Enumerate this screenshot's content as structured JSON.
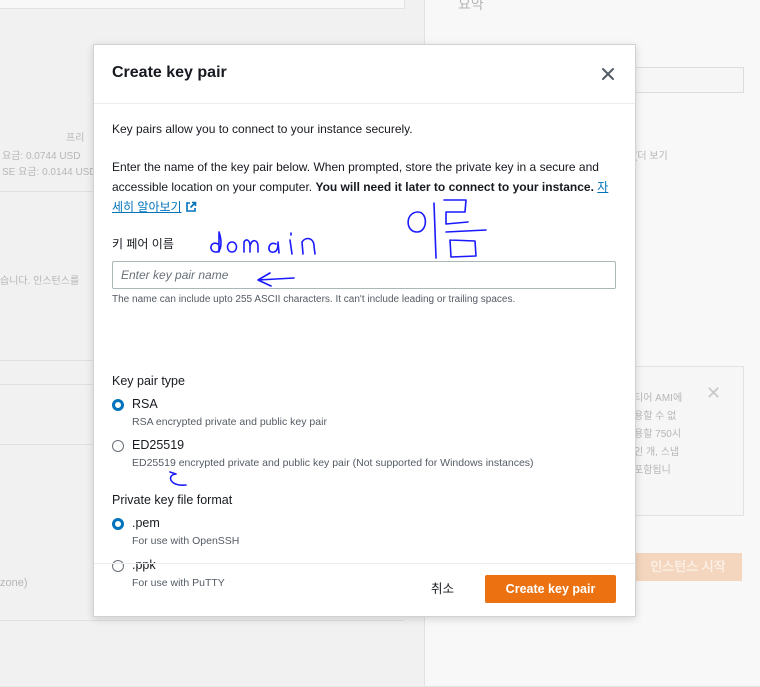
{
  "modal": {
    "title": "Create key pair",
    "intro": "Key pairs allow you to connect to your instance securely.",
    "description_plain": "Enter the name of the key pair below. When prompted, store the private key in a secure and accessible location on your computer.",
    "description_bold": "You will need it later to connect to your instance.",
    "learn_more_link": "자세히 알아보기",
    "name_field": {
      "label": "키 페어 이름",
      "placeholder": "Enter key pair name",
      "value": "",
      "hint": "The name can include upto 255 ASCII characters. It can't include leading or trailing spaces."
    },
    "key_pair_type": {
      "label": "Key pair type",
      "options": [
        {
          "title": "RSA",
          "description": "RSA encrypted private and public key pair",
          "selected": true
        },
        {
          "title": "ED25519",
          "description": "ED25519 encrypted private and public key pair (Not supported for Windows instances)",
          "selected": false
        }
      ]
    },
    "file_format": {
      "label": "Private key file format",
      "options": [
        {
          "title": ".pem",
          "description": "For use with OpenSSH",
          "selected": true
        },
        {
          "title": ".ppk",
          "description": "For use with PuTTY",
          "selected": false
        }
      ]
    },
    "cancel_label": "취소",
    "create_label": "Create key pair"
  },
  "background": {
    "texts": [
      "프리",
      "요금: 0.0744 USD",
      "SE 요금: 0.0144 USD",
      "습니다. 인스턴스를",
      "(더 보기",
      "티어 AMI에",
      "용할 수 없",
      "용할 750시",
      "인 개, 스냅",
      "포함됩니",
      "zone)",
      "인스턴스 시작",
      "요약"
    ],
    "launch_button": "인스턴스 시작"
  },
  "annotations": {
    "handwritten_name": "domain",
    "handwritten_korean": "이름"
  },
  "colors": {
    "primary": "#ec7211",
    "link": "#0073bb",
    "radio_selected": "#0073bb",
    "annotation_ink": "#1a1aff"
  }
}
